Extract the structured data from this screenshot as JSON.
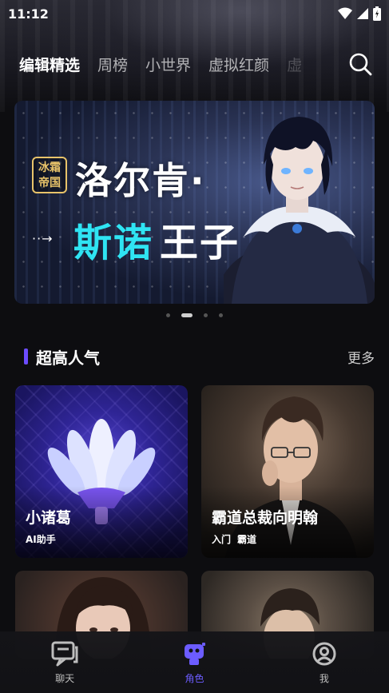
{
  "status_bar": {
    "time": "11:12"
  },
  "top_tabs": [
    {
      "label": "编辑精选",
      "active": true
    },
    {
      "label": "周榜",
      "active": false
    },
    {
      "label": "小世界",
      "active": false
    },
    {
      "label": "虚拟红颜",
      "active": false
    },
    {
      "label": "虚",
      "active": false
    }
  ],
  "banner": {
    "badge_line1": "冰霜",
    "badge_line2": "帝国",
    "title_line1": "洛尔肯·",
    "title_line2_part1": "斯诺",
    "title_line2_part2": "王子",
    "arrow": "··→"
  },
  "carousel": {
    "count": 4,
    "active_index": 1
  },
  "section": {
    "title": "超高人气",
    "more": "更多"
  },
  "cards": [
    {
      "name": "小诸葛",
      "tags": [
        "AI助手"
      ]
    },
    {
      "name": "霸道总裁向明翰",
      "tags": [
        "入门",
        "霸道"
      ]
    },
    {
      "name": "",
      "tags": []
    },
    {
      "name": "",
      "tags": []
    }
  ],
  "bottom_nav": [
    {
      "label": "聊天",
      "icon": "chat-icon",
      "active": false
    },
    {
      "label": "角色",
      "icon": "robot-icon",
      "active": true
    },
    {
      "label": "我",
      "icon": "profile-icon",
      "active": false
    }
  ],
  "colors": {
    "accent": "#6c5cff",
    "banner_cyan": "#2fe4f3",
    "badge_gold": "#e8c36a"
  }
}
